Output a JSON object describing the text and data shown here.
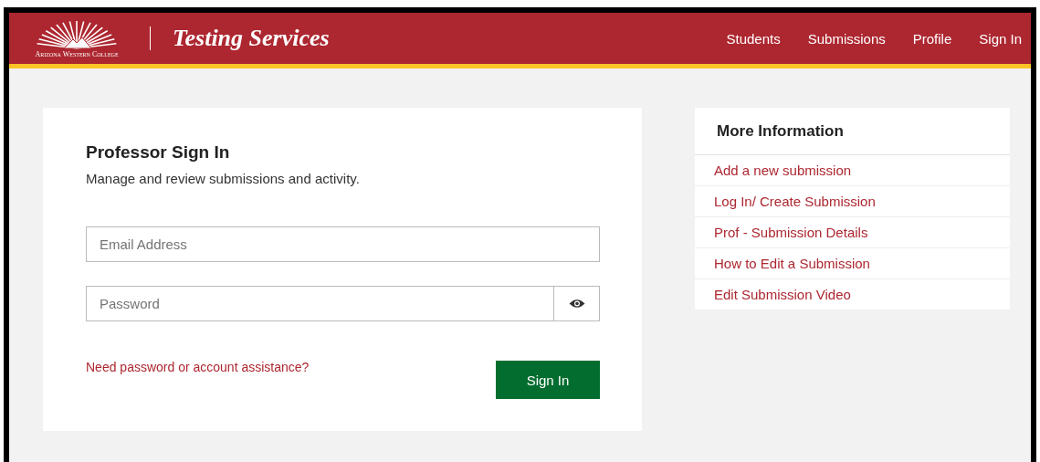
{
  "header": {
    "logo_caption": "Arizona Western College",
    "title": "Testing Services",
    "nav": [
      {
        "label": "Students"
      },
      {
        "label": "Submissions"
      },
      {
        "label": "Profile"
      },
      {
        "label": "Sign In"
      }
    ]
  },
  "signin": {
    "title": "Professor Sign In",
    "subtitle": "Manage and review submissions and activity.",
    "email": {
      "placeholder": "Email Address"
    },
    "password": {
      "placeholder": "Password"
    },
    "help_link": "Need password or account assistance?",
    "button": "Sign In"
  },
  "more_info": {
    "title": "More Information",
    "links": [
      {
        "label": "Add a new submission"
      },
      {
        "label": "Log In/ Create Submission"
      },
      {
        "label": "Prof - Submission Details"
      },
      {
        "label": "How to Edit a Submission"
      },
      {
        "label": "Edit Submission Video"
      }
    ]
  }
}
